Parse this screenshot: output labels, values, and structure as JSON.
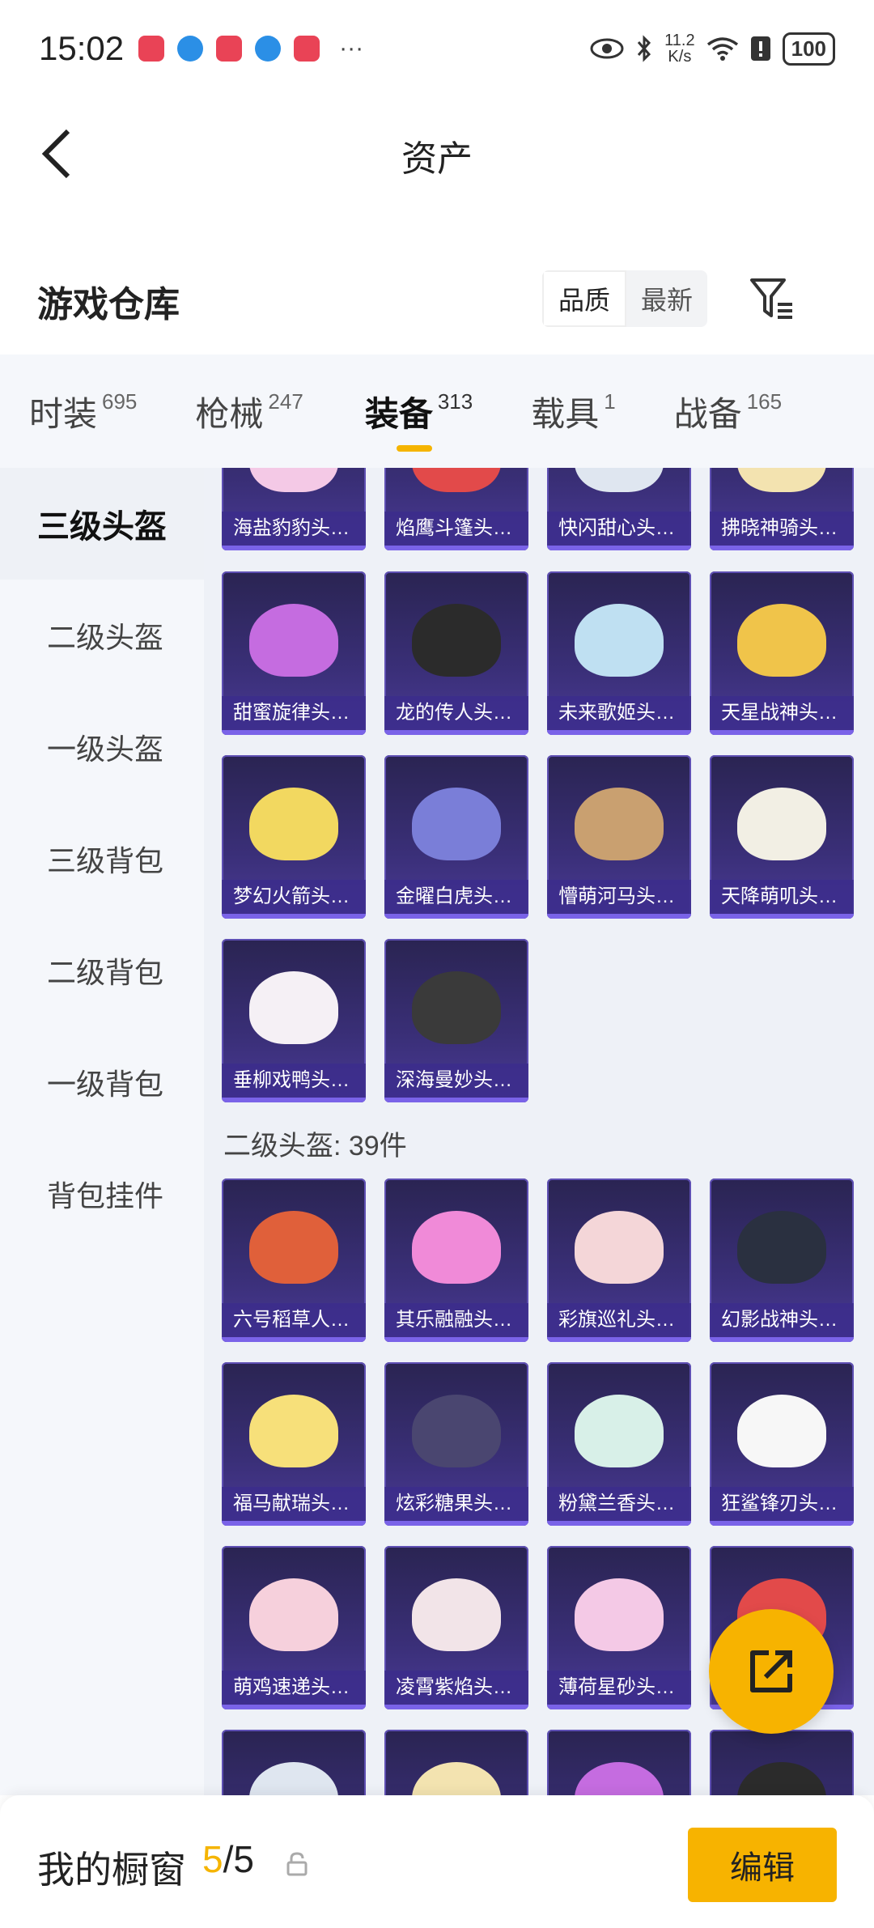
{
  "status_bar": {
    "time": "15:02",
    "speed_value": "11.2",
    "speed_unit": "K/s",
    "battery": "100"
  },
  "header": {
    "title": "资产"
  },
  "section": {
    "title": "游戏仓库",
    "sort_options": [
      "品质",
      "最新"
    ]
  },
  "tabs": [
    {
      "label": "时装",
      "count": "695"
    },
    {
      "label": "枪械",
      "count": "247"
    },
    {
      "label": "装备",
      "count": "313"
    },
    {
      "label": "载具",
      "count": "1"
    },
    {
      "label": "战备",
      "count": "165"
    }
  ],
  "sidebar": {
    "items": [
      "三级头盔",
      "二级头盔",
      "一级头盔",
      "三级背包",
      "二级背包",
      "一级背包",
      "背包挂件"
    ]
  },
  "groups": {
    "top_row": [
      "海盐豹豹头…",
      "焰鹰斗篷头…",
      "快闪甜心头…",
      "拂晓神骑头…"
    ],
    "level3": [
      "甜蜜旋律头…",
      "龙的传人头…",
      "未来歌姬头…",
      "天星战神头…",
      "梦幻火箭头…",
      "金曜白虎头…",
      "懵萌河马头…",
      "天降萌叽头…",
      "垂柳戏鸭头…",
      "深海曼妙头…"
    ],
    "level2_title": "二级头盔: 39件",
    "level2": [
      "六号稻草人…",
      "其乐融融头…",
      "彩旗巡礼头…",
      "幻影战神头…",
      "福马献瑞头…",
      "炫彩糖果头…",
      "粉黛兰香头…",
      "狂鲨锋刃头…",
      "萌鸡速递头…",
      "凌霄紫焰头…",
      "薄荷星砂头…",
      ""
    ]
  },
  "bottom_bar": {
    "title": "我的橱窗",
    "current": "5",
    "total": "/5",
    "edit_label": "编辑"
  },
  "colors": {
    "accent": "#f7b300",
    "card_bg": "#3a2f78"
  }
}
